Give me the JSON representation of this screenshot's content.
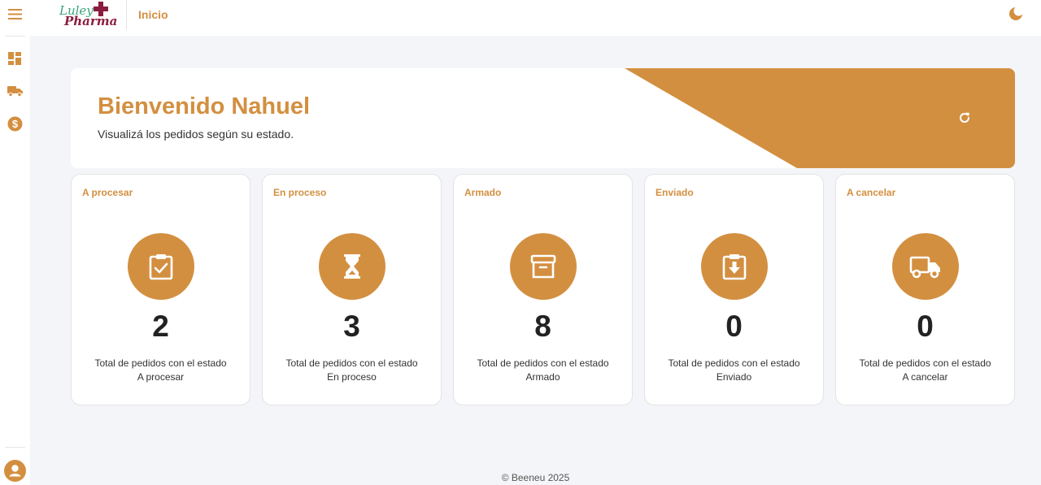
{
  "app": {
    "logo_line1": "Luley",
    "logo_line2": "Pharma",
    "breadcrumb": "Inicio"
  },
  "sidebar": {
    "icons": [
      "menu-icon",
      "dashboard-icon",
      "truck-icon",
      "dollar-icon",
      "user-icon"
    ]
  },
  "hero": {
    "title": "Bienvenido Nahuel",
    "subtitle": "Visualizá los pedidos según su estado."
  },
  "cards": [
    {
      "title": "A procesar",
      "count": "2",
      "desc_line1": "Total de pedidos con el estado",
      "desc_line2": "A procesar",
      "icon": "clipboard-check-icon"
    },
    {
      "title": "En proceso",
      "count": "3",
      "desc_line1": "Total de pedidos con el estado",
      "desc_line2": "En proceso",
      "icon": "hourglass-icon"
    },
    {
      "title": "Armado",
      "count": "8",
      "desc_line1": "Total de pedidos con el estado",
      "desc_line2": "Armado",
      "icon": "archive-box-icon"
    },
    {
      "title": "Enviado",
      "count": "0",
      "desc_line1": "Total de pedidos con el estado",
      "desc_line2": "Enviado",
      "icon": "download-box-icon"
    },
    {
      "title": "A cancelar",
      "count": "0",
      "desc_line1": "Total de pedidos con el estado",
      "desc_line2": "A cancelar",
      "icon": "truck-icon"
    }
  ],
  "footer": {
    "text": "© Beeneu 2025"
  },
  "colors": {
    "accent": "#d38f40",
    "logo_green": "#3aa57a",
    "logo_maroon": "#8b1d3f",
    "background": "#f4f5f8"
  }
}
